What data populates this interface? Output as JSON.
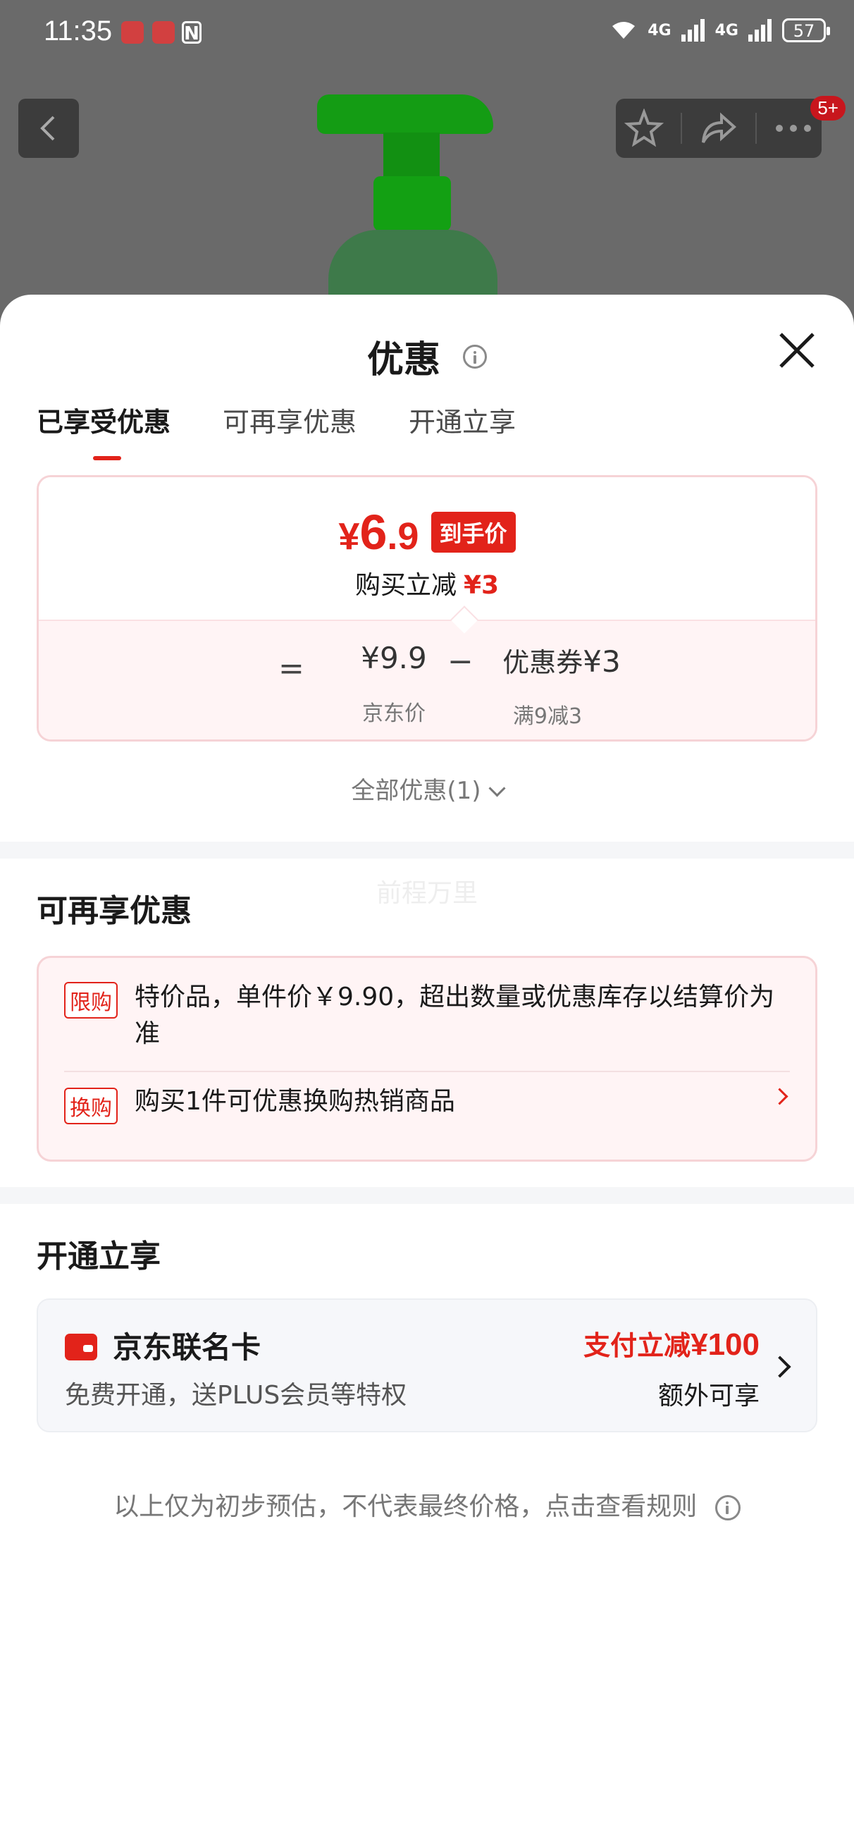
{
  "status_bar": {
    "time": "11:35",
    "network_1": "4G",
    "network_2": "4G",
    "battery": "57"
  },
  "background_page": {
    "action_badge": "5+"
  },
  "sheet": {
    "title": "优惠",
    "tabs": [
      {
        "label": "已享受优惠",
        "active": true
      },
      {
        "label": "可再享优惠",
        "active": false
      },
      {
        "label": "开通立享",
        "active": false
      }
    ],
    "price_card": {
      "currency": "¥",
      "final_price_int": "6",
      "final_price_dec": ".9",
      "arrive_tag": "到手价",
      "reduce_label": "购买立减",
      "reduce_amount": "¥3",
      "equals": "=",
      "jd_price": "¥9.9",
      "jd_price_label": "京东价",
      "minus": "−",
      "coupon_label": "优惠券",
      "coupon_amount": "¥3",
      "coupon_rule": "满9减3"
    },
    "all_offers": "全部优惠(1)",
    "watermark": "前程万里",
    "more_offers": {
      "title": "可再享优惠",
      "items": [
        {
          "tag": "限购",
          "text": "特价品，单件价￥9.90，超出数量或优惠库存以结算价为准"
        },
        {
          "tag": "换购",
          "text": "购买1件可优惠换购热销商品"
        }
      ]
    },
    "open_enjoy": {
      "title": "开通立享",
      "card_name": "京东联名卡",
      "card_sub": "免费开通，送PLUS会员等特权",
      "promo_label": "支付立减",
      "promo_amount": "¥100",
      "extra": "额外可享"
    },
    "disclaimer": "以上仅为初步预估，不代表最终价格，点击查看规则"
  },
  "colors": {
    "accent_red": "#e2231a",
    "overlay": "#5f5f5f",
    "card_pink": "#fff4f5"
  }
}
